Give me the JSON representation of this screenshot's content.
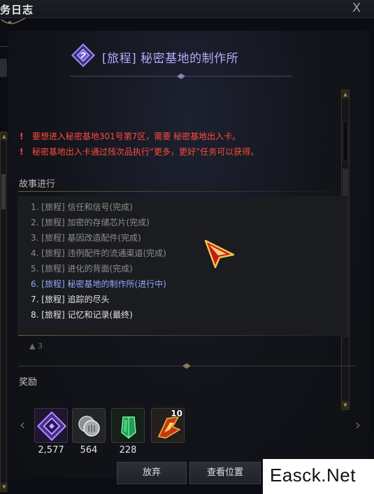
{
  "window": {
    "title": "务日志",
    "close_glyph": "X"
  },
  "quest": {
    "title": "[旅程] 秘密基地的制作所",
    "warnings": [
      "要想进入秘密基地301号第7区，需要 秘密基地出入卡。",
      "秘密基地出入卡通过残次品执行“更多，更好”任务可以获得。"
    ],
    "warning_mark": "!"
  },
  "progress": {
    "label": "故事进行",
    "steps": [
      {
        "text": "1. [旅程] 信任和信号(完成)",
        "state": "done"
      },
      {
        "text": "2. [旅程] 加密的存储芯片(完成)",
        "state": "done"
      },
      {
        "text": "3. [旅程] 基因改造配件(完成)",
        "state": "done"
      },
      {
        "text": "4. [旅程] 违例配件的流通渠道(完成)",
        "state": "done"
      },
      {
        "text": "5. [旅程] 进化的背面(完成)",
        "state": "done"
      },
      {
        "text": "6. [旅程] 秘密基地的制作所(进行中)",
        "state": "current"
      },
      {
        "text": "7. [旅程] 追踪的尽头",
        "state": "pending"
      },
      {
        "text": "8. [旅程] 记忆和记录(最终)",
        "state": "pending"
      }
    ],
    "faded_value": "3"
  },
  "rewards": {
    "label": "奖励",
    "items": [
      {
        "icon": "purple-crystal-icon",
        "count": "2,577"
      },
      {
        "icon": "silver-coin-icon",
        "count": "564"
      },
      {
        "icon": "green-gem-icon",
        "count": "228"
      },
      {
        "icon": "fire-shard-icon",
        "count": "",
        "stack": "10"
      }
    ],
    "prev_glyph": "‹",
    "next_glyph": "›"
  },
  "buttons": {
    "abandon": "放弃",
    "view_location": "查看位置"
  },
  "watermark": "Easck.Net",
  "colors": {
    "title": "#b7a9ff",
    "warning": "#ff4a3d",
    "current_step": "#8fa8ff",
    "done_step": "#8e8e8e"
  }
}
